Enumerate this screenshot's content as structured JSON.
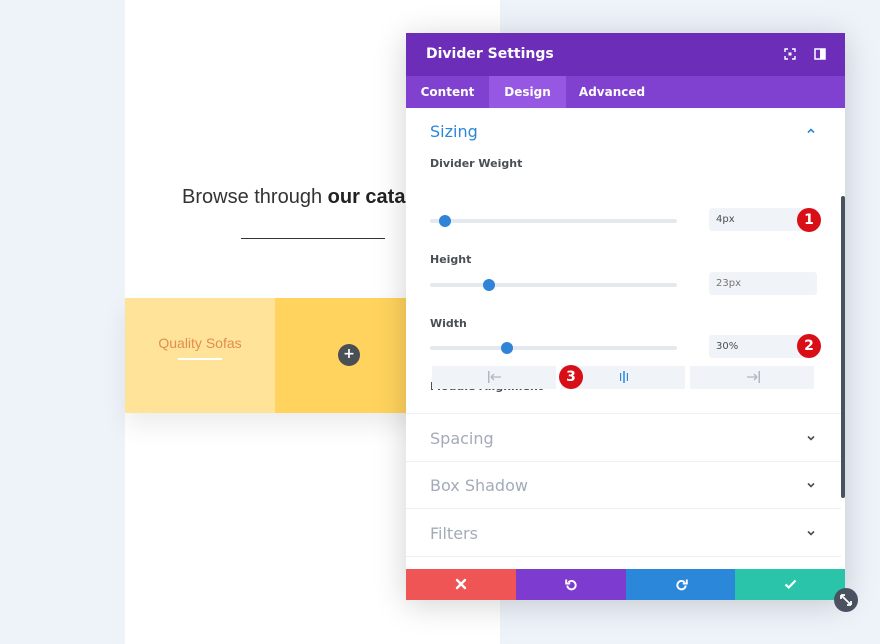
{
  "page": {
    "heading_regular": "Browse through ",
    "heading_bold": "our catalo",
    "card_title": "Quality Sofas",
    "add_icon": "plus-icon"
  },
  "modal": {
    "title": "Divider Settings",
    "header_icons": [
      "focus-icon",
      "sidebar-toggle-icon"
    ],
    "tabs": [
      {
        "label": "Content",
        "active": false
      },
      {
        "label": "Design",
        "active": true
      },
      {
        "label": "Advanced",
        "active": false
      }
    ],
    "sizing": {
      "title": "Sizing",
      "divider_weight": {
        "label": "Divider Weight",
        "value": "4px",
        "slider_percent": 6
      },
      "height": {
        "label": "Height",
        "value": "23px",
        "slider_percent": 24
      },
      "width": {
        "label": "Width",
        "value": "30%",
        "slider_percent": 31
      },
      "module_alignment": {
        "label": "Module Alignment",
        "options": [
          "align-left-icon",
          "align-center-icon",
          "align-right-icon"
        ],
        "selected": "align-center-icon"
      }
    },
    "sections": [
      {
        "title": "Spacing"
      },
      {
        "title": "Box Shadow"
      },
      {
        "title": "Filters"
      }
    ],
    "badges": [
      "1",
      "2",
      "3"
    ],
    "footer": [
      "cancel-icon",
      "undo-icon",
      "redo-icon",
      "save-icon"
    ]
  },
  "colors": {
    "header": "#6c2eb9",
    "tabs": "#8141d0",
    "accent": "#2b87da",
    "cancel": "#ef5555",
    "undo": "#7e3bd0",
    "redo": "#2b87da",
    "save": "#29c4a9",
    "badge": "#d80f16"
  }
}
